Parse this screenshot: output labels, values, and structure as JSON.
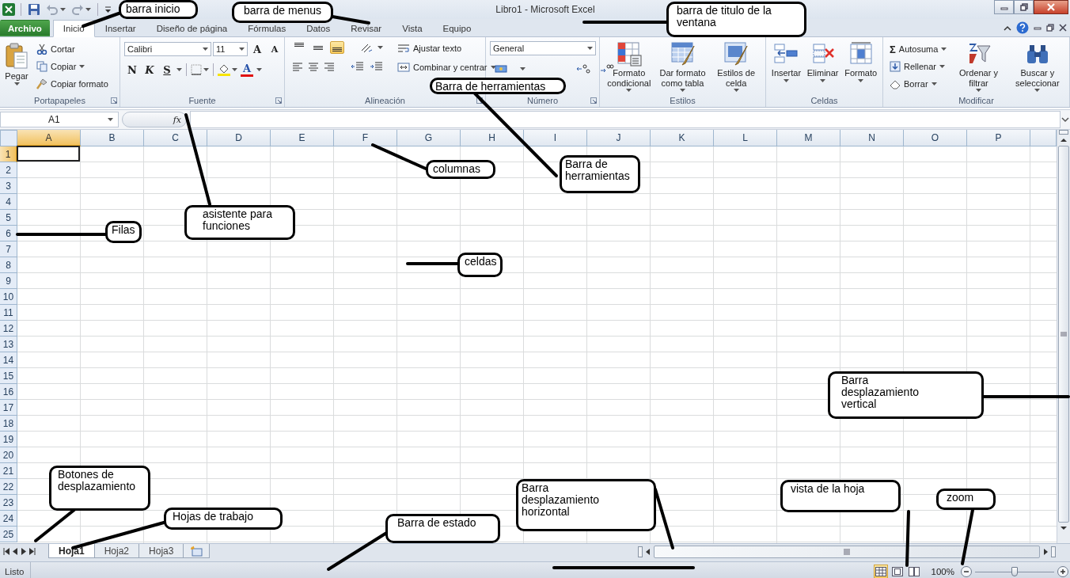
{
  "window": {
    "title": "Libro1  -  Microsoft Excel"
  },
  "tabs": [
    {
      "label": "Archivo",
      "kind": "file",
      "selected": false
    },
    {
      "label": "Inicio",
      "kind": "tab",
      "selected": true
    },
    {
      "label": "Insertar",
      "kind": "tab",
      "selected": false
    },
    {
      "label": "Diseño de página",
      "kind": "tab",
      "selected": false
    },
    {
      "label": "Fórmulas",
      "kind": "tab",
      "selected": false
    },
    {
      "label": "Datos",
      "kind": "tab",
      "selected": false
    },
    {
      "label": "Revisar",
      "kind": "tab",
      "selected": false
    },
    {
      "label": "Vista",
      "kind": "tab",
      "selected": false
    },
    {
      "label": "Equipo",
      "kind": "tab",
      "selected": false
    }
  ],
  "ribbon": [
    {
      "kind": "clipboard",
      "label": "Portapapeles",
      "launcher": true,
      "paste": "Pegar",
      "cut": "Cortar",
      "copy": "Copiar",
      "format_painter": "Copiar formato"
    },
    {
      "kind": "font",
      "label": "Fuente",
      "launcher": true,
      "font": "Calibri",
      "size": "11",
      "grow": "A",
      "shrink": "A",
      "bold": "N",
      "italic": "K",
      "underline": "S",
      "font_color": "A"
    },
    {
      "kind": "alignment",
      "label": "Alineación",
      "launcher": true,
      "wrap_text": "Ajustar texto",
      "merge": "Combinar y centrar"
    },
    {
      "kind": "number",
      "label": "Número",
      "launcher": true,
      "format": "General"
    },
    {
      "kind": "styles",
      "label": "Estilos",
      "launcher": false,
      "buttons": [
        {
          "label": "Formato condicional"
        },
        {
          "label": "Dar formato como tabla"
        },
        {
          "label": "Estilos de celda"
        }
      ]
    },
    {
      "kind": "cells",
      "label": "Celdas",
      "launcher": false,
      "buttons": [
        {
          "label": "Insertar"
        },
        {
          "label": "Eliminar"
        },
        {
          "label": "Formato"
        }
      ]
    },
    {
      "kind": "editing",
      "label": "Modificar",
      "launcher": false,
      "autosum_symbol": "Σ",
      "autosum": "Autosuma",
      "fill": "Rellenar",
      "clear": "Borrar",
      "buttons": [
        {
          "label": "Ordenar y filtrar"
        },
        {
          "label": "Buscar y seleccionar"
        }
      ]
    }
  ],
  "formula_bar": {
    "name_box": "A1",
    "function_label": "fx"
  },
  "grid": {
    "columns": [
      {
        "label": "A",
        "selected": true
      },
      {
        "label": "B",
        "selected": false
      },
      {
        "label": "C",
        "selected": false
      },
      {
        "label": "D",
        "selected": false
      },
      {
        "label": "E",
        "selected": false
      },
      {
        "label": "F",
        "selected": false
      },
      {
        "label": "G",
        "selected": false
      },
      {
        "label": "H",
        "selected": false
      },
      {
        "label": "I",
        "selected": false
      },
      {
        "label": "J",
        "selected": false
      },
      {
        "label": "K",
        "selected": false
      },
      {
        "label": "L",
        "selected": false
      },
      {
        "label": "M",
        "selected": false
      },
      {
        "label": "N",
        "selected": false
      },
      {
        "label": "O",
        "selected": false
      },
      {
        "label": "P",
        "selected": false
      }
    ],
    "rows": [
      {
        "label": "1",
        "selected": true
      },
      {
        "label": "2",
        "selected": false
      },
      {
        "label": "3",
        "selected": false
      },
      {
        "label": "4",
        "selected": false
      },
      {
        "label": "5",
        "selected": false
      },
      {
        "label": "6",
        "selected": false
      },
      {
        "label": "7",
        "selected": false
      },
      {
        "label": "8",
        "selected": false
      },
      {
        "label": "9",
        "selected": false
      },
      {
        "label": "10",
        "selected": false
      },
      {
        "label": "11",
        "selected": false
      },
      {
        "label": "12",
        "selected": false
      },
      {
        "label": "13",
        "selected": false
      },
      {
        "label": "14",
        "selected": false
      },
      {
        "label": "15",
        "selected": false
      },
      {
        "label": "16",
        "selected": false
      },
      {
        "label": "17",
        "selected": false
      },
      {
        "label": "18",
        "selected": false
      },
      {
        "label": "19",
        "selected": false
      },
      {
        "label": "20",
        "selected": false
      },
      {
        "label": "21",
        "selected": false
      },
      {
        "label": "22",
        "selected": false
      },
      {
        "label": "23",
        "selected": false
      },
      {
        "label": "24",
        "selected": false
      },
      {
        "label": "25",
        "selected": false
      }
    ]
  },
  "sheet_tabs": [
    {
      "label": "Hoja1",
      "selected": true
    },
    {
      "label": "Hoja2",
      "selected": false
    },
    {
      "label": "Hoja3",
      "selected": false
    }
  ],
  "status_bar": {
    "text": "Listo",
    "views": [
      {
        "selected": true
      },
      {
        "selected": false
      },
      {
        "selected": false
      }
    ],
    "zoom": {
      "reading": "100%",
      "level": 0.5
    }
  },
  "annotations": [
    {
      "text": "barra inicio"
    },
    {
      "text": "barra de menus"
    },
    {
      "text": "barra de titulo de la ventana"
    },
    {
      "text": "Barra de herramientas"
    },
    {
      "text": "columnas"
    },
    {
      "text": "Barra de herramientas"
    },
    {
      "text": "Filas"
    },
    {
      "text": "asistente para funciones"
    },
    {
      "text": "celdas"
    },
    {
      "text": "Barra desplazamiento vertical"
    },
    {
      "text": "Botones de desplazamiento"
    },
    {
      "text": "Hojas de trabajo"
    },
    {
      "text": "Barra de estado"
    },
    {
      "text": "Barra desplazamiento horizontal"
    },
    {
      "text": "vista de la hoja"
    },
    {
      "text": "zoom"
    }
  ]
}
